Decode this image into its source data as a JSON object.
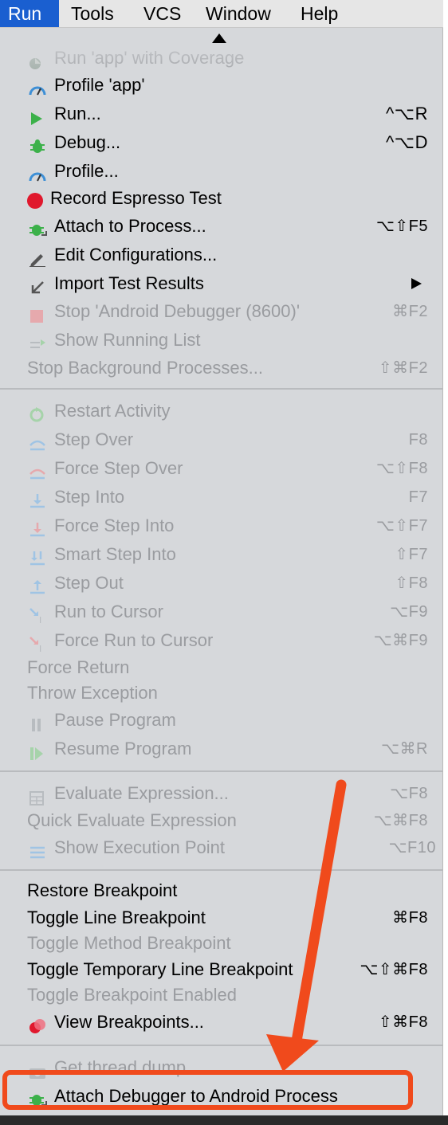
{
  "menubar": {
    "items": [
      "Run",
      "Tools",
      "VCS",
      "Window",
      "Help"
    ]
  },
  "menu": {
    "items": [
      {
        "label": "Run 'app' with Coverage",
        "shortcut": "",
        "enabled": false,
        "icon": "coverage-icon"
      },
      {
        "label": "Profile 'app'",
        "shortcut": "",
        "enabled": true,
        "icon": "profile-gauge-icon"
      },
      {
        "label": "Run...",
        "shortcut": "^⌥R",
        "enabled": true,
        "icon": "run-play-icon"
      },
      {
        "label": "Debug...",
        "shortcut": "^⌥D",
        "enabled": true,
        "icon": "debug-bug-icon"
      },
      {
        "label": "Profile...",
        "shortcut": "",
        "enabled": true,
        "icon": "profile-gauge-icon"
      },
      {
        "label": "Record Espresso Test",
        "shortcut": "",
        "enabled": true,
        "icon": "record-icon"
      },
      {
        "label": "Attach to Process...",
        "shortcut": "⌥⇧F5",
        "enabled": true,
        "icon": "attach-bug-icon"
      },
      {
        "label": "Edit Configurations...",
        "shortcut": "",
        "enabled": true,
        "icon": "edit-pencil-icon"
      },
      {
        "label": "Import Test Results",
        "shortcut": "",
        "enabled": true,
        "icon": "import-arrow-icon"
      },
      {
        "label": "Stop 'Android Debugger (8600)'",
        "shortcut": "⌘F2",
        "enabled": false,
        "icon": "stop-square-icon"
      },
      {
        "label": "Show Running List",
        "shortcut": "",
        "enabled": false,
        "icon": "running-list-icon"
      },
      {
        "label": "Stop Background Processes...",
        "shortcut": "⇧⌘F2",
        "enabled": false,
        "icon": ""
      },
      {
        "label": "Restart Activity",
        "shortcut": "",
        "enabled": false,
        "icon": "restart-icon"
      },
      {
        "label": "Step Over",
        "shortcut": "F8",
        "enabled": false,
        "icon": "step-over-icon"
      },
      {
        "label": "Force Step Over",
        "shortcut": "⌥⇧F8",
        "enabled": false,
        "icon": "force-step-over-icon"
      },
      {
        "label": "Step Into",
        "shortcut": "F7",
        "enabled": false,
        "icon": "step-into-icon"
      },
      {
        "label": "Force Step Into",
        "shortcut": "⌥⇧F7",
        "enabled": false,
        "icon": "force-step-into-icon"
      },
      {
        "label": "Smart Step Into",
        "shortcut": "⇧F7",
        "enabled": false,
        "icon": "smart-step-into-icon"
      },
      {
        "label": "Step Out",
        "shortcut": "⇧F8",
        "enabled": false,
        "icon": "step-out-icon"
      },
      {
        "label": "Run to Cursor",
        "shortcut": "⌥F9",
        "enabled": false,
        "icon": "run-to-cursor-icon"
      },
      {
        "label": "Force Run to Cursor",
        "shortcut": "⌥⌘F9",
        "enabled": false,
        "icon": "force-run-to-cursor-icon"
      },
      {
        "label": "Force Return",
        "shortcut": "",
        "enabled": false,
        "icon": ""
      },
      {
        "label": "Throw Exception",
        "shortcut": "",
        "enabled": false,
        "icon": ""
      },
      {
        "label": "Pause Program",
        "shortcut": "",
        "enabled": false,
        "icon": "pause-icon"
      },
      {
        "label": "Resume Program",
        "shortcut": "⌥⌘R",
        "enabled": false,
        "icon": "resume-icon"
      },
      {
        "label": "Evaluate Expression...",
        "shortcut": "⌥F8",
        "enabled": false,
        "icon": "calculator-icon"
      },
      {
        "label": "Quick Evaluate Expression",
        "shortcut": "⌥⌘F8",
        "enabled": false,
        "icon": ""
      },
      {
        "label": "Show Execution Point",
        "shortcut": "⌥F10",
        "enabled": false,
        "icon": "execution-point-icon"
      },
      {
        "label": "Restore Breakpoint",
        "shortcut": "",
        "enabled": true,
        "icon": ""
      },
      {
        "label": "Toggle Line Breakpoint",
        "shortcut": "⌘F8",
        "enabled": true,
        "icon": ""
      },
      {
        "label": "Toggle Method Breakpoint",
        "shortcut": "",
        "enabled": false,
        "icon": ""
      },
      {
        "label": "Toggle Temporary Line Breakpoint",
        "shortcut": "⌥⇧⌘F8",
        "enabled": true,
        "icon": ""
      },
      {
        "label": "Toggle Breakpoint Enabled",
        "shortcut": "",
        "enabled": false,
        "icon": ""
      },
      {
        "label": "View Breakpoints...",
        "shortcut": "⇧⌘F8",
        "enabled": true,
        "icon": "breakpoints-icon"
      },
      {
        "label": "Get thread dump",
        "shortcut": "",
        "enabled": false,
        "icon": "camera-icon"
      },
      {
        "label": "Attach Debugger to Android Process",
        "shortcut": "",
        "enabled": true,
        "icon": "attach-android-debugger-icon"
      }
    ]
  },
  "colors": {
    "menubar_active": "#1a5fd0",
    "menu_background": "#d6d8db",
    "disabled_text": "#9a9ca0",
    "annotation": "#f04a1c",
    "run_green": "#3cb14a",
    "record_red": "#e0182d",
    "profile_blue": "#3d8fd6"
  }
}
